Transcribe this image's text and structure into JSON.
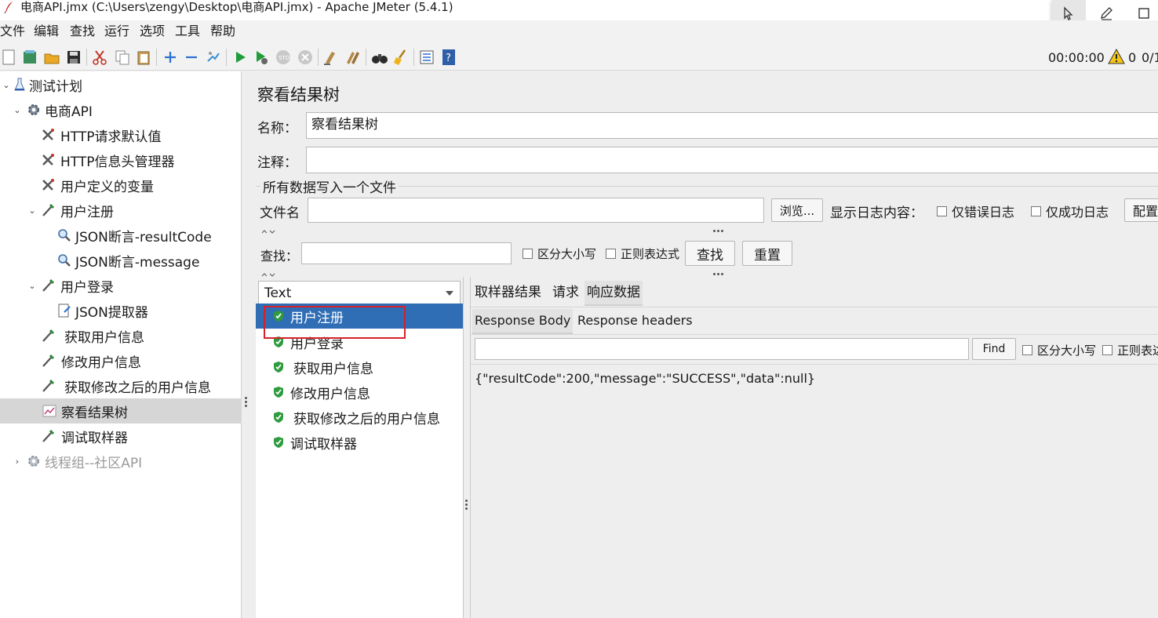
{
  "window": {
    "title": "电商API.jmx (C:\\Users\\zengy\\Desktop\\电商API.jmx) - Apache JMeter (5.4.1)"
  },
  "menu": [
    "文件",
    "编辑",
    "查找",
    "运行",
    "选项",
    "工具",
    "帮助"
  ],
  "toolbar": {
    "timer": "00:00:00",
    "warning_count": "0",
    "thread_ratio": "0/1"
  },
  "tree": {
    "test_plan": "测试计划",
    "thread_group": "电商API",
    "http_defaults": "HTTP请求默认值",
    "header_manager": "HTTP信息头管理器",
    "user_vars": "用户定义的变量",
    "register": "用户注册",
    "assert_code": "JSON断言-resultCode",
    "assert_msg": "JSON断言-message",
    "login": "用户登录",
    "json_extractor": "JSON提取器",
    "get_user": "获取用户信息",
    "modify_user": "修改用户信息",
    "get_modified": "获取修改之后的用户信息",
    "view_tree": "察看结果树",
    "debug_sampler": "调试取样器",
    "community_group": "线程组--社区API"
  },
  "panel": {
    "heading": "察看结果树",
    "name_label": "名称：",
    "name_value": "察看结果树",
    "comment_label": "注释：",
    "comment_value": "",
    "file_section": "所有数据写入一个文件",
    "filename_label": "文件名",
    "filename_value": "",
    "browse_button": "浏览...",
    "log_display_label": "显示日志内容：",
    "errors_only": "仅错误日志",
    "success_only": "仅成功日志",
    "configure_button": "配置",
    "search_label": "查找：",
    "search_value": "",
    "case_sensitive": "区分大小写",
    "regex": "正则表达式",
    "search_button": "查找",
    "reset_button": "重置"
  },
  "results": {
    "renderer": "Text",
    "items": [
      "用户注册",
      "用户登录",
      "获取用户信息",
      "修改用户信息",
      "获取修改之后的用户信息",
      "调试取样器"
    ],
    "selected_index": 0
  },
  "detail": {
    "tabs": [
      "取样器结果",
      "请求",
      "响应数据"
    ],
    "active_tab": "响应数据",
    "subtabs": [
      "Response Body",
      "Response headers"
    ],
    "active_subtab": "Response Body",
    "find_value": "",
    "find_button": "Find",
    "case_sensitive": "区分大小写",
    "regex": "正则表达",
    "body": "{\"resultCode\":200,\"message\":\"SUCCESS\",\"data\":null}"
  }
}
